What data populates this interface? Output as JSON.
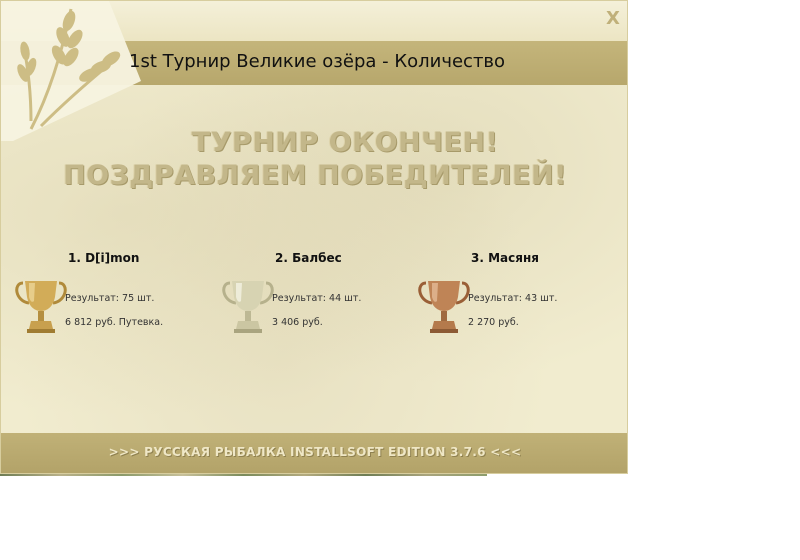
{
  "window": {
    "title": "1st Турнир Великие озёра - Количество",
    "close_label": "X"
  },
  "headline": {
    "line1": "ТУРНИР ОКОНЧЕН!",
    "line2": "ПОЗДРАВЛЯЕМ ПОБЕДИТЕЛЕЙ!"
  },
  "winners": [
    {
      "place_name": "1. D[i]mon",
      "result": "Результат: 75 шт.",
      "prize": "6 812 руб. Путевка.",
      "cup": "gold-trophy-icon"
    },
    {
      "place_name": "2. Балбес",
      "result": "Результат: 44 шт.",
      "prize": "3 406 руб.",
      "cup": "silver-trophy-icon"
    },
    {
      "place_name": "3. Масяня",
      "result": "Результат: 43 шт.",
      "prize": "2 270 руб.",
      "cup": "bronze-trophy-icon"
    }
  ],
  "footer": {
    "text": ">>> РУССКАЯ РЫБАЛКА INSTALLSOFT EDITION 3.7.6 <<<"
  },
  "colors": {
    "panel": "#f1eccf",
    "band": "#bcad72",
    "gold": "#c9a24a",
    "silver": "#c9c6a8",
    "bronze": "#b87a4b"
  }
}
